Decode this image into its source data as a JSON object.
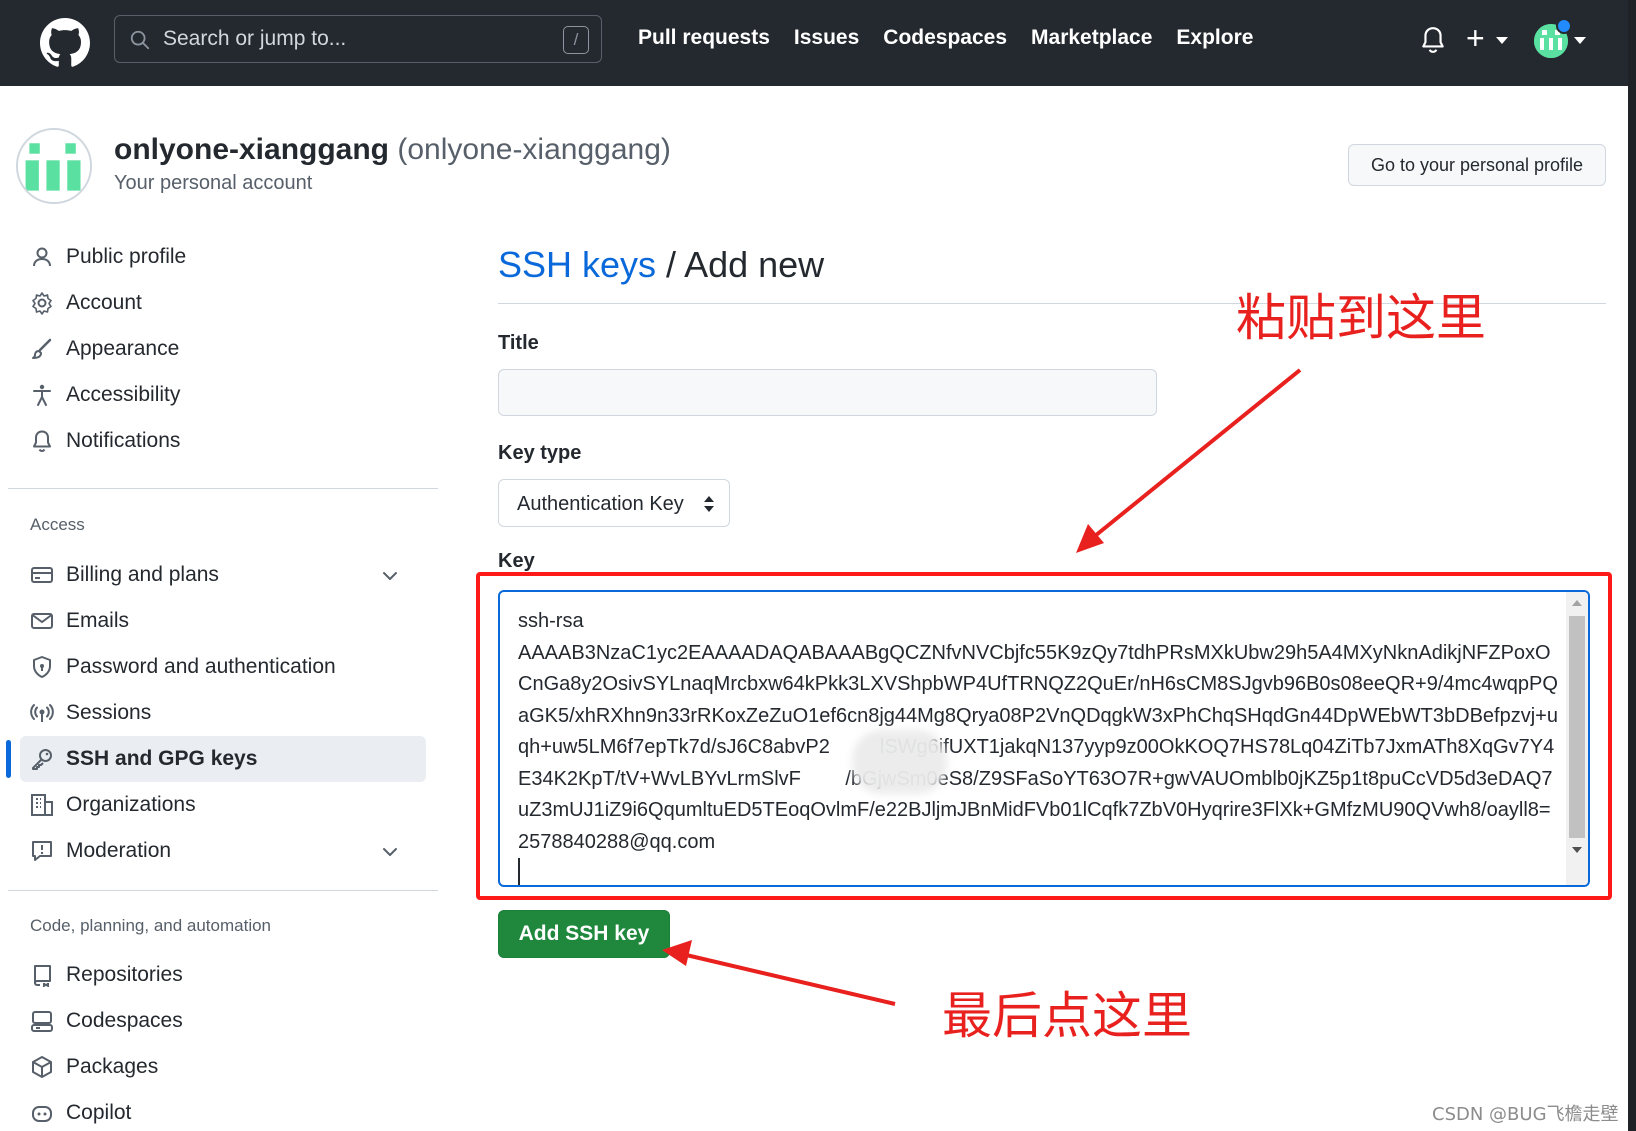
{
  "header": {
    "search_placeholder": "Search or jump to...",
    "search_shortcut": "/",
    "nav": [
      "Pull requests",
      "Issues",
      "Codespaces",
      "Marketplace",
      "Explore"
    ],
    "plus": "+"
  },
  "account": {
    "name": "onlyone-xianggang",
    "login": "(onlyone-xianggang)",
    "subtitle": "Your personal account",
    "profile_button": "Go to your personal profile"
  },
  "sidebar": {
    "items": [
      {
        "label": "Public profile",
        "icon": "person-icon"
      },
      {
        "label": "Account",
        "icon": "gear-icon"
      },
      {
        "label": "Appearance",
        "icon": "paintbrush-icon"
      },
      {
        "label": "Accessibility",
        "icon": "accessibility-icon"
      },
      {
        "label": "Notifications",
        "icon": "bell-icon"
      }
    ],
    "access_heading": "Access",
    "access_items": [
      {
        "label": "Billing and plans",
        "icon": "credit-card-icon"
      },
      {
        "label": "Emails",
        "icon": "mail-icon"
      },
      {
        "label": "Password and authentication",
        "icon": "shield-lock-icon"
      },
      {
        "label": "Sessions",
        "icon": "broadcast-icon"
      },
      {
        "label": "SSH and GPG keys",
        "icon": "key-icon"
      },
      {
        "label": "Organizations",
        "icon": "organization-icon"
      },
      {
        "label": "Moderation",
        "icon": "report-icon"
      }
    ],
    "code_heading": "Code, planning, and automation",
    "code_items": [
      {
        "label": "Repositories",
        "icon": "repo-icon"
      },
      {
        "label": "Codespaces",
        "icon": "codespaces-icon"
      },
      {
        "label": "Packages",
        "icon": "package-icon"
      },
      {
        "label": "Copilot",
        "icon": "copilot-icon"
      }
    ]
  },
  "main": {
    "breadcrumb_link": "SSH keys",
    "breadcrumb_sep": " / ",
    "breadcrumb_current": "Add new",
    "title_label": "Title",
    "title_value": "",
    "key_type_label": "Key type",
    "key_type_value": "Authentication Key",
    "key_label": "Key",
    "key_value": "ssh-rsa\nAAAAB3NzaC1yc2EAAAADAQABAAABgQCZNfvNVCbjfc55K9zQy7tdhPRsMXkUbw29h5A4MXyNknAdikjNFZPoxOCnGa8y2OsivSYLnaqMrcbxw64kPkk3LXVShpbWP4UfTRNQZ2QuEr/nH6sCM8SJgvb96B0s08eeQR+9/4mc4wqpPQaGK5/xhRXhn9n33rRKoxZeZuO1ef6cn8jg44Mg8Qrya08P2VnQDqgkW3xPhChqSHqdGn44DpWEbWT3bDBefpzvj+uqh+uw5LM6f7epTk7d/sJ6C8abvP2         lSWg6ifUXT1jakqN137yyp9z00OkKOQ7HS78Lq04ZiTb7JxmATh8XqGv7Y4E34K2KpT/tV+WvLBYvLrmSlvF        /bGjwSm0eS8/Z9SFaSoYT63O7R+gwVAUOmblb0jKZ5p1t8puCcVD5d3eDAQ7uZ3mUJ1iZ9i6QqumltuED5TEoqOvlmF/e22BJljmJBnMidFVb01lCqfk7ZbV0Hyqrire3FlXk+GMfzMU90QVwh8/oayll8= 2578840288@qq.com\n",
    "submit_label": "Add SSH key"
  },
  "annotations": {
    "paste_here": "粘贴到这里",
    "click_here": "最后点这里",
    "color": "#e8211f"
  },
  "watermark": "CSDN @BUG飞檐走壁"
}
